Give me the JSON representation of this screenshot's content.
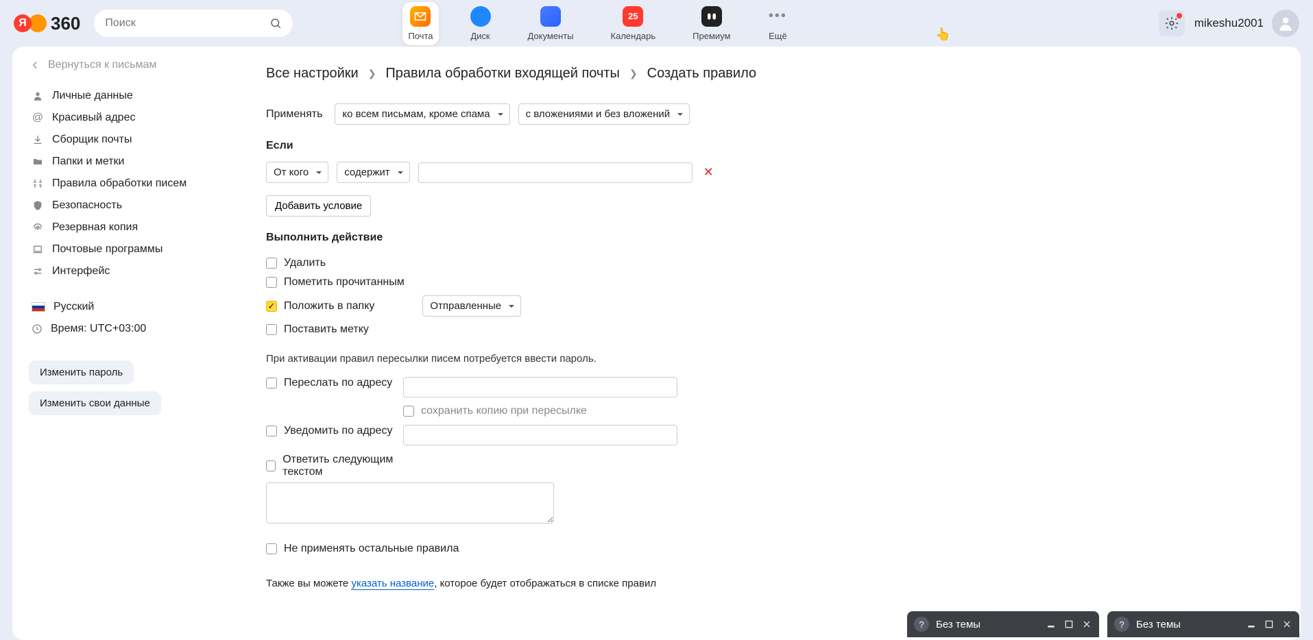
{
  "header": {
    "logo_text": "360",
    "search_placeholder": "Поиск",
    "apps": [
      {
        "label": "Почта",
        "key": "mail"
      },
      {
        "label": "Диск",
        "key": "disk"
      },
      {
        "label": "Документы",
        "key": "docs"
      },
      {
        "label": "Календарь",
        "key": "cal",
        "badge": "25"
      },
      {
        "label": "Премиум",
        "key": "prem"
      },
      {
        "label": "Ещё",
        "key": "more"
      }
    ],
    "username": "mikeshu2001"
  },
  "sidebar": {
    "back": "Вернуться к письмам",
    "items": [
      {
        "label": "Личные данные"
      },
      {
        "label": "Красивый адрес"
      },
      {
        "label": "Сборщик почты"
      },
      {
        "label": "Папки и метки"
      },
      {
        "label": "Правила обработки писем"
      },
      {
        "label": "Безопасность"
      },
      {
        "label": "Резервная копия"
      },
      {
        "label": "Почтовые программы"
      },
      {
        "label": "Интерфейс"
      }
    ],
    "language": "Русский",
    "time": "Время: UTC+03:00",
    "change_password": "Изменить пароль",
    "change_data": "Изменить свои данные"
  },
  "breadcrumb": {
    "a": "Все настройки",
    "b": "Правила обработки входящей почты",
    "c": "Создать правило"
  },
  "form": {
    "apply_label": "Применять",
    "apply_sel1": "ко всем письмам, кроме спама",
    "apply_sel2": "с вложениями и без вложений",
    "if_title": "Если",
    "cond_field": "От кого",
    "cond_op": "содержит",
    "add_condition": "Добавить условие",
    "action_title": "Выполнить действие",
    "actions": {
      "delete": "Удалить",
      "mark_read": "Пометить прочитанным",
      "move_folder": "Положить в папку",
      "folder_selected": "Отправленные",
      "set_label": "Поставить метку"
    },
    "forward_note": "При активации правил пересылки писем потребуется ввести пароль.",
    "forward": "Переслать по адресу",
    "keep_copy": "сохранить копию при пересылке",
    "notify": "Уведомить по адресу",
    "reply_text": "Ответить следующим текстом",
    "skip_others": "Не применять остальные правила",
    "name_note_pre": "Также вы можете ",
    "name_note_link": "указать название",
    "name_note_post": ", которое будет отображаться в списке правил"
  },
  "taskbar": {
    "item_title": "Без темы"
  }
}
